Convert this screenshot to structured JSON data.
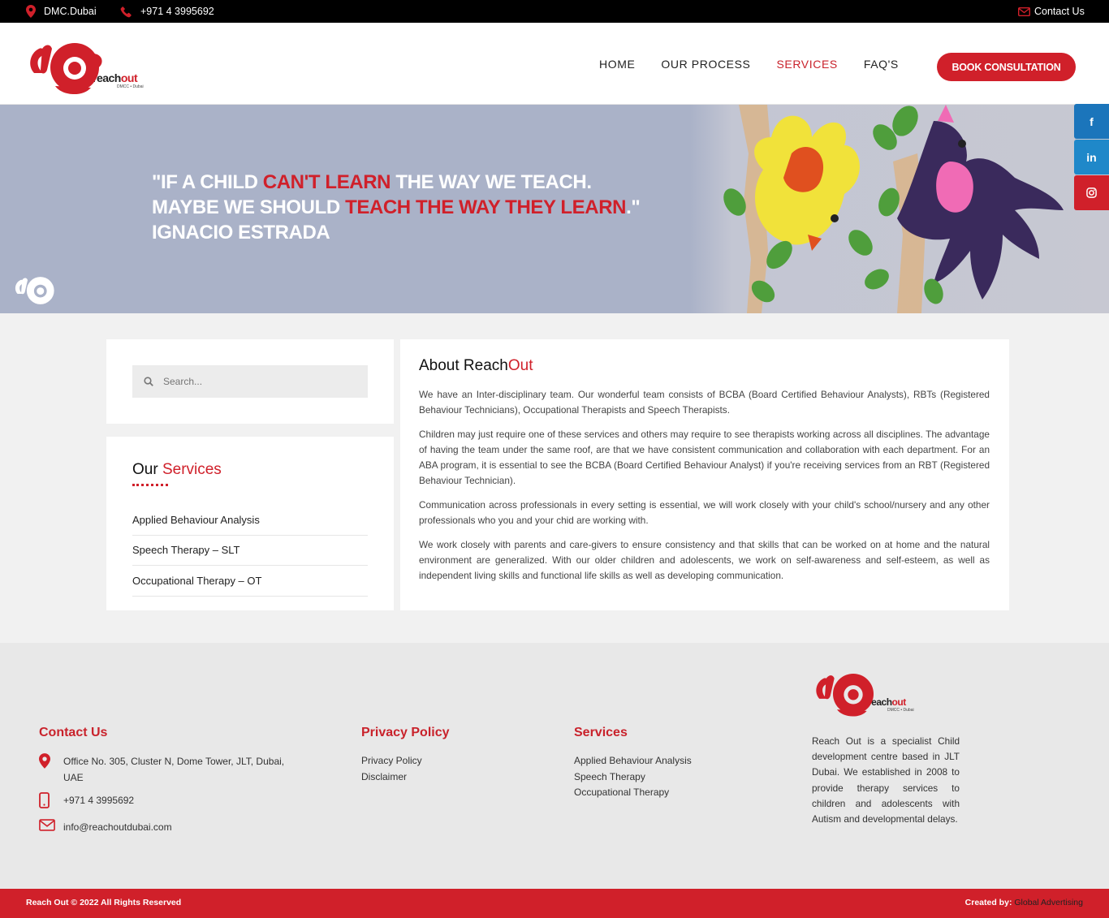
{
  "topbar": {
    "location": "DMC.Dubai",
    "phone": "+971 4 3995692",
    "contact": "Contact Us"
  },
  "brand": {
    "word_a": "reach",
    "word_b": "out",
    "tagline": "DMCC • Dubai",
    "accent": "#d0202a"
  },
  "nav": {
    "items": [
      "HOME",
      "OUR PROCESS",
      "SERVICES",
      "FAQ'S"
    ],
    "active": "SERVICES",
    "cta": "BOOK CONSULTATION"
  },
  "social": {
    "facebook": "f",
    "linkedin": "in",
    "instagram": "instagram-icon"
  },
  "hero": {
    "q1a": "\"IF A CHILD ",
    "q1b": "CAN'T LEARN",
    "q1c": " THE WAY WE TEACH.",
    "q2a": "MAYBE WE SHOULD ",
    "q2b": "TEACH THE WAY THEY LEARN",
    "q2c": ".\"",
    "q3": "IGNACIO ESTRADA"
  },
  "search": {
    "placeholder": "Search..."
  },
  "services_widget": {
    "title_a": "Our ",
    "title_b": "Services",
    "items": [
      "Applied Behaviour Analysis",
      "Speech Therapy – SLT",
      "Occupational Therapy – OT"
    ]
  },
  "about": {
    "title_a": "About Reach",
    "title_b": "Out",
    "paragraphs": [
      "We have an Inter-disciplinary team. Our wonderful team consists of BCBA (Board Certified Behaviour Analysts), RBTs (Registered Behaviour Technicians), Occupational Therapists and Speech Therapists.",
      "Children may just require one of these services and others may require to see therapists working across all disciplines. The advantage of having the team under the same roof, are that we have consistent communication and collaboration with each department. For an ABA program, it is essential to see the BCBA (Board Certified Behaviour Analyst) if you're receiving services from an RBT (Registered Behaviour Technician).",
      "Communication across professionals in every setting is essential, we will work closely with your child's school/nursery and any other professionals who you and your chid are working with.",
      "We work closely with parents and care-givers to ensure consistency and that skills that can be worked on at home and the natural environment are generalized. With our older children and adolescents, we work on self-awareness and self-esteem, as well as independent living skills and functional life skills as well as developing communication."
    ]
  },
  "footer": {
    "contact_title": "Contact Us",
    "address": "Office No. 305, Cluster N, Dome Tower, JLT, Dubai, UAE",
    "phone": "+971 4 3995692",
    "email": "info@reachoutdubai.com",
    "privacy_title": "Privacy Policy",
    "privacy_links": [
      "Privacy Policy",
      "Disclaimer"
    ],
    "services_title": "Services",
    "services_links": [
      "Applied Behaviour Analysis",
      "Speech Therapy",
      "Occupational Therapy"
    ],
    "about_text": "Reach Out is a specialist Child development centre based in JLT Dubai. We established in 2008 to provide therapy services to children and adolescents with Autism and developmental delays."
  },
  "bottombar": {
    "copyright": "Reach Out © 2022  All Rights Reserved",
    "created_label": "Created by:",
    "created_by": "Global Advertising"
  }
}
